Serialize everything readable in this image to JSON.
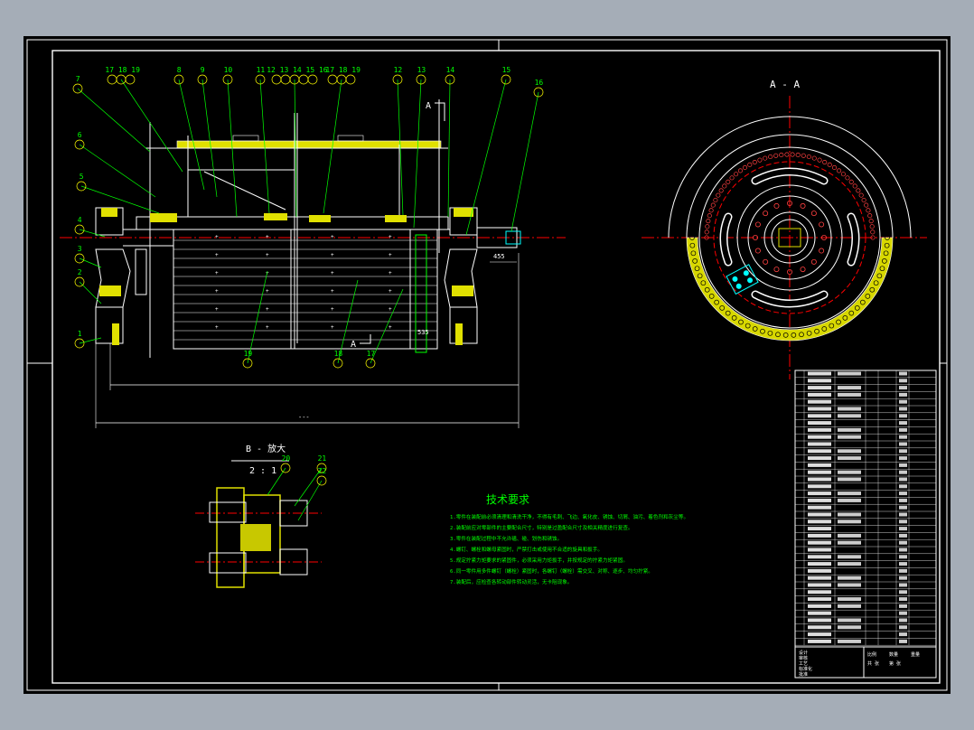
{
  "drawing": {
    "section_label": "A - A",
    "detail_title": "B - 放大",
    "detail_scale": "2 : 1",
    "section_marker_top": "A",
    "section_marker_bottom": "A",
    "dimension_small": "455",
    "dimension_total": "---",
    "dimension_side": "535"
  },
  "balloons_top": [
    "17",
    "18",
    "19",
    "8",
    "9",
    "10",
    "11",
    "12",
    "13",
    "14",
    "15",
    "16",
    "12",
    "13",
    "14",
    "15",
    "16",
    "17",
    "18",
    "19"
  ],
  "top_callouts": [
    {
      "label": "17 18 19"
    },
    {
      "label": "8"
    },
    {
      "label": "9"
    },
    {
      "label": "10"
    },
    {
      "label": "11"
    },
    {
      "label": "12 13 14 15 16"
    },
    {
      "label": "17 18 19"
    },
    {
      "label": "12"
    },
    {
      "label": "13"
    },
    {
      "label": "14"
    },
    {
      "label": "15"
    },
    {
      "label": "16"
    }
  ],
  "left_callouts": [
    {
      "label": "7"
    },
    {
      "label": "6"
    },
    {
      "label": "5"
    },
    {
      "label": "4"
    },
    {
      "label": "3"
    },
    {
      "label": "2"
    },
    {
      "label": "1"
    }
  ],
  "bottom_callouts": [
    {
      "label": "19"
    },
    {
      "label": "18"
    },
    {
      "label": "17"
    }
  ],
  "detail_callouts": [
    {
      "label": "20"
    },
    {
      "label": "21"
    },
    {
      "label": "22"
    }
  ],
  "tech_req": {
    "title": "技术要求",
    "lines": [
      "1.零件在装配前必须清理和清洗干净，不得有毛刺、飞边、氧化皮、锈蚀、切屑、油污、着色剂和灰尘等。",
      "2.装配前应对零部件的主要配合尺寸，特别是过盈配合尺寸及相关精度进行复查。",
      "3.零件在装配过程中不允许磕、碰、划伤和锈蚀。",
      "4.螺钉、螺栓和螺母紧固时，严禁打击或使用不合适的旋具和扳手。",
      "5.规定拧紧力矩要求的紧固件，必须采用力矩扳手，并按规定的拧紧力矩紧固。",
      "6.同一零件用多件螺钉（螺栓）紧固时，各螺钉（螺栓）需交叉、对称、逐步、均匀拧紧。",
      "7.装配后，应检查各转动部件转动灵活，无卡阻现象。"
    ]
  },
  "bom": {
    "rows": 39,
    "footer": [
      "设计",
      "审核",
      "工艺",
      "标准化",
      "批准"
    ],
    "title_block": [
      "比例",
      "数量",
      "重量",
      "共 张",
      "第 张"
    ]
  },
  "colors": {
    "sheet": "#000000",
    "frame": "#ffffff",
    "outline": "#ffffff",
    "leader": "#00ff00",
    "centerline": "#ff0000",
    "balloon": "#ffff00",
    "fill_yellow": "#e0e000",
    "cyan": "#00ffff",
    "magenta": "#ff00ff"
  }
}
